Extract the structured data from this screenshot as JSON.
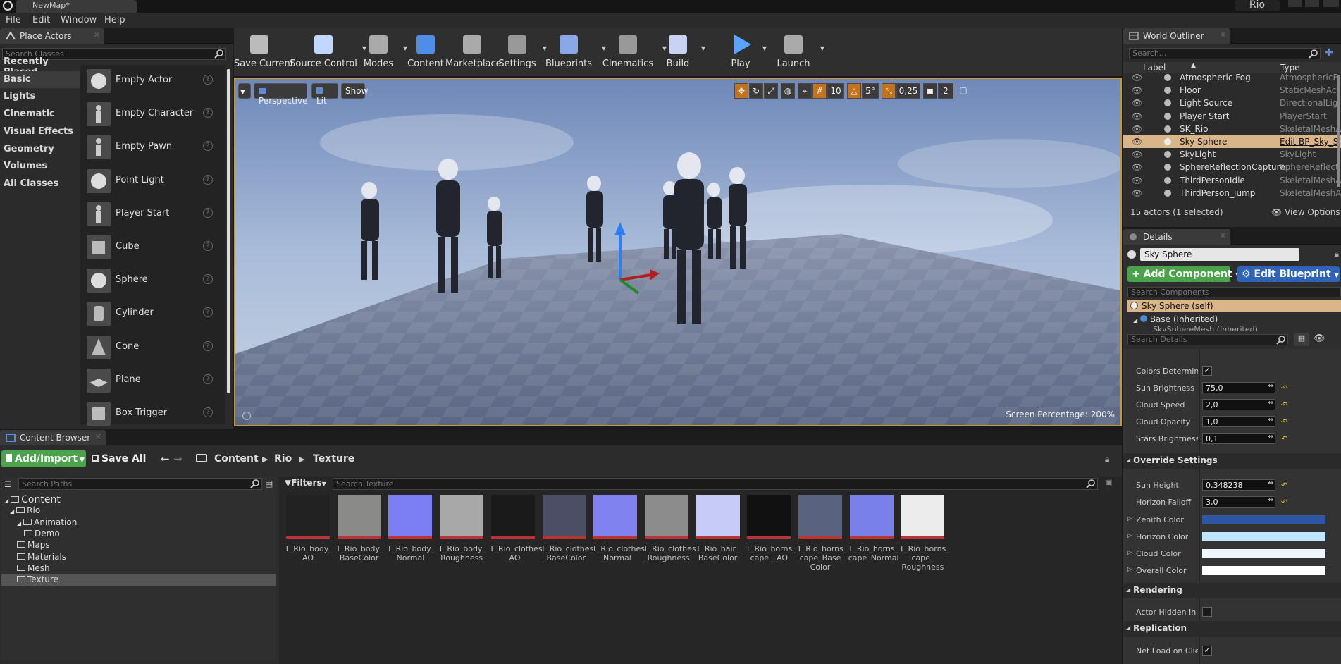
{
  "window": {
    "title": "NewMap*",
    "project": "Rio"
  },
  "menu": [
    "File",
    "Edit",
    "Window",
    "Help"
  ],
  "place_actors": {
    "tab": "Place Actors",
    "search_placeholder": "Search Classes",
    "categories": [
      "Recently Placed",
      "Basic",
      "Lights",
      "Cinematic",
      "Visual Effects",
      "Geometry",
      "Volumes",
      "All Classes"
    ],
    "selected_category": "Basic",
    "actors": [
      "Empty Actor",
      "Empty Character",
      "Empty Pawn",
      "Point Light",
      "Player Start",
      "Cube",
      "Sphere",
      "Cylinder",
      "Cone",
      "Plane",
      "Box Trigger"
    ]
  },
  "toolbar": [
    "Save Current",
    "Source Control",
    "Modes",
    "Content",
    "Marketplace",
    "Settings",
    "Blueprints",
    "Cinematics",
    "Build",
    "Play",
    "Launch"
  ],
  "viewport": {
    "perspective": "Perspective",
    "lit": "Lit",
    "show": "Show",
    "grid_snap": "10",
    "rot_snap": "5°",
    "scale_snap": "0,25",
    "cam_speed": "2",
    "screen_percentage_label": "Screen Percentage:",
    "screen_percentage": "200%"
  },
  "content_browser": {
    "tab": "Content Browser",
    "add_import": "Add/Import",
    "save_all": "Save All",
    "breadcrumb": [
      "Content",
      "Rio",
      "Texture"
    ],
    "search_paths": "Search Paths",
    "filters": "Filters",
    "search_placeholder": "Search Texture",
    "tree": [
      "Content",
      "Rio",
      "Animation",
      "Demo",
      "Maps",
      "Materials",
      "Mesh",
      "Texture"
    ],
    "assets": [
      {
        "name": "T_Rio_body_\nAO",
        "color": "#222"
      },
      {
        "name": "T_Rio_body_\nBaseColor",
        "color": "#8a8a88"
      },
      {
        "name": "T_Rio_body_\nNormal",
        "color": "#7b7ff2"
      },
      {
        "name": "T_Rio_body_\nRoughness",
        "color": "#a8a8a8"
      },
      {
        "name": "T_Rio_clothes\n_AO",
        "color": "#1a1a1a"
      },
      {
        "name": "T_Rio_clothes\n_BaseColor",
        "color": "#4c4e66"
      },
      {
        "name": "T_Rio_clothes\n_Normal",
        "color": "#7f82ef"
      },
      {
        "name": "T_Rio_clothes\n_Roughness",
        "color": "#8c8c8c"
      },
      {
        "name": "T_Rio_hair_\nBaseColor",
        "color": "#c7cbf8"
      },
      {
        "name": "T_Rio_horns_\ncape__AO",
        "color": "#111"
      },
      {
        "name": "T_Rio_horns_\ncape_Base\nColor",
        "color": "#59627e"
      },
      {
        "name": "T_Rio_horns_\ncape_Normal",
        "color": "#7a80ea"
      },
      {
        "name": "T_Rio_horns_\ncape_\nRoughness",
        "color": "#ececec"
      }
    ]
  },
  "outliner": {
    "tab": "World Outliner",
    "search_placeholder": "Search...",
    "col_label": "Label",
    "col_type": "Type",
    "rows": [
      {
        "label": "Atmospheric Fog",
        "type": "AtmosphericF"
      },
      {
        "label": "Floor",
        "type": "StaticMeshAct"
      },
      {
        "label": "Light Source",
        "type": "DirectionalLig"
      },
      {
        "label": "Player Start",
        "type": "PlayerStart"
      },
      {
        "label": "SK_Rio",
        "type": "SkeletalMeshA"
      },
      {
        "label": "Sky Sphere",
        "type": "Edit BP_Sky_S"
      },
      {
        "label": "SkyLight",
        "type": "SkyLight"
      },
      {
        "label": "SphereReflectionCapture",
        "type": "SphereReflecti"
      },
      {
        "label": "ThirdPersonIdle",
        "type": "SkeletalMeshA"
      },
      {
        "label": "ThirdPerson_Jump",
        "type": "SkeletalMeshA"
      }
    ],
    "selected_row": "Sky Sphere",
    "count": "15 actors (1 selected)",
    "view_options": "View Options"
  },
  "details": {
    "tab": "Details",
    "name": "Sky Sphere",
    "add_component": "Add Component",
    "edit_blueprint": "Edit Blueprint",
    "search_components": "Search Components",
    "self": "Sky Sphere (self)",
    "base": "Base (Inherited)",
    "mesh": "SkySphereMesh (Inherited)",
    "search_details": "Search Details",
    "props": [
      {
        "label": "Colors Determined",
        "value": "check"
      },
      {
        "label": "Sun Brightness",
        "value": "75,0"
      },
      {
        "label": "Cloud Speed",
        "value": "2,0"
      },
      {
        "label": "Cloud Opacity",
        "value": "1,0"
      },
      {
        "label": "Stars Brightness",
        "value": "0,1"
      }
    ],
    "override_section": "Override Settings",
    "override": [
      {
        "label": "Sun Height",
        "value": "0,348238"
      },
      {
        "label": "Horizon Falloff",
        "value": "3,0"
      }
    ],
    "colors": [
      {
        "label": "Zenith Color",
        "color": "#2d57a5"
      },
      {
        "label": "Horizon Color",
        "color": "#bfe6ff"
      },
      {
        "label": "Cloud Color",
        "color": "#f0f6ff"
      },
      {
        "label": "Overall Color",
        "color": "#ffffff"
      }
    ],
    "rendering_section": "Rendering",
    "actor_hidden": "Actor Hidden In Ga",
    "replication_section": "Replication",
    "net_load": "Net Load on Client"
  }
}
